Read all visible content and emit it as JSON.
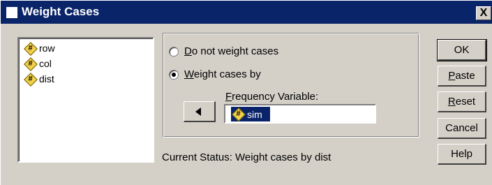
{
  "window": {
    "title": "Weight Cases",
    "close_label": "X"
  },
  "variables": [
    {
      "name": "row",
      "icon": "numeric-variable-icon"
    },
    {
      "name": "col",
      "icon": "numeric-variable-icon"
    },
    {
      "name": "dist",
      "icon": "numeric-variable-icon"
    }
  ],
  "options": {
    "do_not_weight": {
      "prefix": "",
      "mnemonic": "D",
      "rest": "o not weight cases",
      "selected": false
    },
    "weight_by": {
      "prefix": "",
      "mnemonic": "W",
      "rest": "eight cases by",
      "selected": true
    }
  },
  "frequency": {
    "label_mnemonic": "F",
    "label_rest": "requency Variable:",
    "value": "sim",
    "move_button_icon": "left-arrow-icon"
  },
  "status": "Current Status: Weight cases by dist",
  "buttons": {
    "ok": "OK",
    "paste_mnemonic": "P",
    "paste_rest": "aste",
    "reset_mnemonic": "R",
    "reset_rest": "eset",
    "cancel": "Cancel",
    "help": "Help"
  },
  "colors": {
    "titlebar": "#0a246a",
    "face": "#d4d0c8",
    "variable_icon": "#f2d04a"
  }
}
